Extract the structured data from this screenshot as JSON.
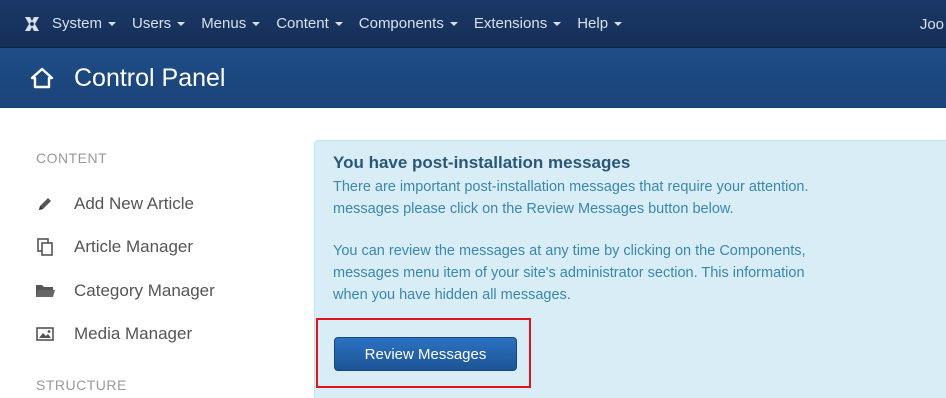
{
  "navbar": {
    "menus": [
      {
        "label": "System"
      },
      {
        "label": "Users"
      },
      {
        "label": "Menus"
      },
      {
        "label": "Content"
      },
      {
        "label": "Components"
      },
      {
        "label": "Extensions"
      },
      {
        "label": "Help"
      }
    ],
    "right_label": "Joo"
  },
  "header": {
    "title": "Control Panel",
    "icon": "home-icon"
  },
  "sidebar": {
    "content_heading": "CONTENT",
    "items": [
      {
        "label": "Add New Article",
        "icon": "pencil-icon"
      },
      {
        "label": "Article Manager",
        "icon": "copy-icon"
      },
      {
        "label": "Category Manager",
        "icon": "folder-icon"
      },
      {
        "label": "Media Manager",
        "icon": "image-icon"
      }
    ],
    "structure_heading": "STRUCTURE"
  },
  "message": {
    "title": "You have post-installation messages",
    "line1": "There are important post-installation messages that require your attention.",
    "line2": "messages please click on the Review Messages button below.",
    "line3": "You can review the messages at any time by clicking on the Components,",
    "line4": "messages menu item of your site's administrator section. This information",
    "line5": "when you have hidden all messages.",
    "button_label": "Review Messages"
  },
  "colors": {
    "navbar": "#1a3867",
    "subhead": "#1f4d87",
    "panel_bg": "#d9edf7",
    "button": "#2b72c2",
    "highlight": "#e0151b"
  }
}
